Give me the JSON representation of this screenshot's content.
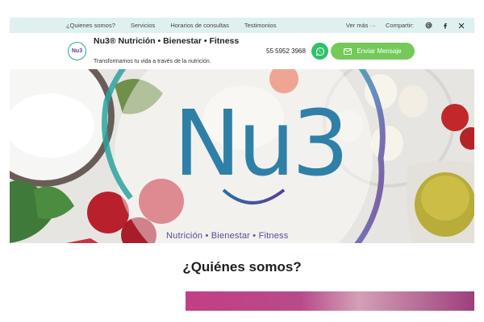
{
  "topnav": {
    "items": [
      "¿Quienes somos?",
      "Servicios",
      "Horarios de consultas",
      "Testimonios"
    ],
    "more": "Ver más ···",
    "share": "Compartir:",
    "social_icons": [
      "at-icon",
      "facebook-icon",
      "x-icon"
    ]
  },
  "header": {
    "logo_text": "Nu3",
    "title": "Nu3® Nutrición • Bienestar • Fitness",
    "tagline": "Transformamos tu vida a través de la nutrición.",
    "phone": "55 5952 3968",
    "message_button": "Enviar Mensaje"
  },
  "hero": {
    "logo_text": "Nu3",
    "caption": "Nutrición • Bienestar • Fitness"
  },
  "section": {
    "title": "¿Quiénes somos?"
  },
  "colors": {
    "topbar_bg": "#dff0f3",
    "brand_purple": "#5d3f98",
    "brand_teal": "#2aa6a1",
    "whatsapp_green": "#2fc16a",
    "message_button_green": "#74c95a"
  }
}
